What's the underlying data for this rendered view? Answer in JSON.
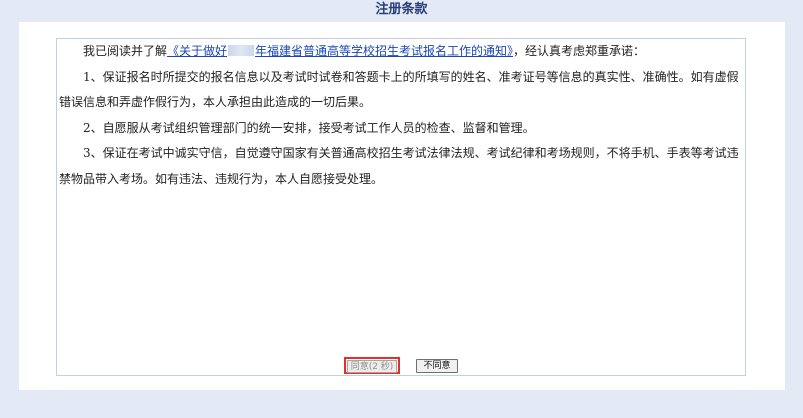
{
  "header": {
    "title": "注册条款"
  },
  "terms": {
    "intro_prefix": "我已阅读并了解",
    "notice_link_pre": "《关于做好",
    "notice_link_post": "年福建省普通高等学校招生考试报名工作的通知》",
    "intro_suffix": "，经认真考虑郑重承诺：",
    "items": [
      "1、保证报名时所提交的报名信息以及考试时试卷和答题卡上的所填写的姓名、准考证号等信息的真实性、准确性。如有虚假错误信息和弄虚作假行为，本人承担由此造成的一切后果。",
      "2、自愿服从考试组织管理部门的统一安排，接受考试工作人员的检查、监督和管理。",
      "3、保证在考试中诚实守信，自觉遵守国家有关普通高校招生考试法律法规、考试纪律和考场规则，不将手机、手表等考试违禁物品带入考场。如有违法、违规行为，本人自愿接受处理。"
    ]
  },
  "buttons": {
    "agree_label": "同意(2 秒)",
    "disagree_label": "不同意"
  }
}
